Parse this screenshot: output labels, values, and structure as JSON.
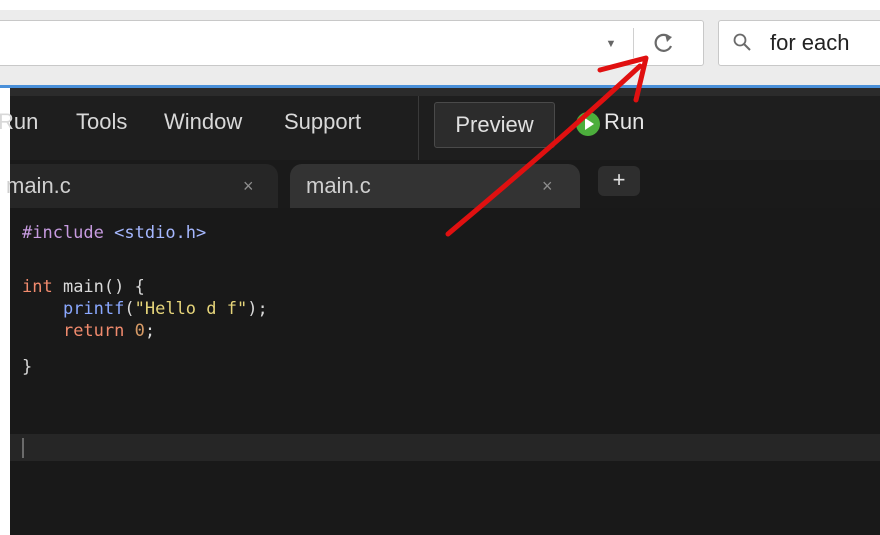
{
  "browser": {
    "url_dropdown_icon": "dropdown-triangle-icon",
    "reload_icon": "reload-icon",
    "search": {
      "icon": "magnifier-icon",
      "value": "for each"
    },
    "accent_color": "#4a90d9"
  },
  "app": {
    "menu": [
      "Run",
      "Tools",
      "Window",
      "Support"
    ],
    "preview_label": "Preview",
    "run_label": "Run",
    "run_icon_color": "#4cae3c"
  },
  "tabs": [
    {
      "label": "main.c",
      "close": "×"
    },
    {
      "label": "main.c",
      "close": "×"
    }
  ],
  "new_tab_label": "+",
  "editor": {
    "lines": [
      {
        "pre": "#include",
        "inc": "<stdio.h>"
      },
      {
        "kw": "int",
        "rest": " main() {"
      },
      {
        "indent": "    ",
        "fn": "printf",
        "open": "(",
        "str": "\"Hello d f\"",
        "close": ");"
      },
      {
        "indent": "    ",
        "kw": "return",
        "sp": " ",
        "num": "0",
        "end": ";"
      },
      {
        "text": "}"
      }
    ]
  },
  "annotation": {
    "color": "#e01010",
    "points_to": "reload-icon"
  }
}
